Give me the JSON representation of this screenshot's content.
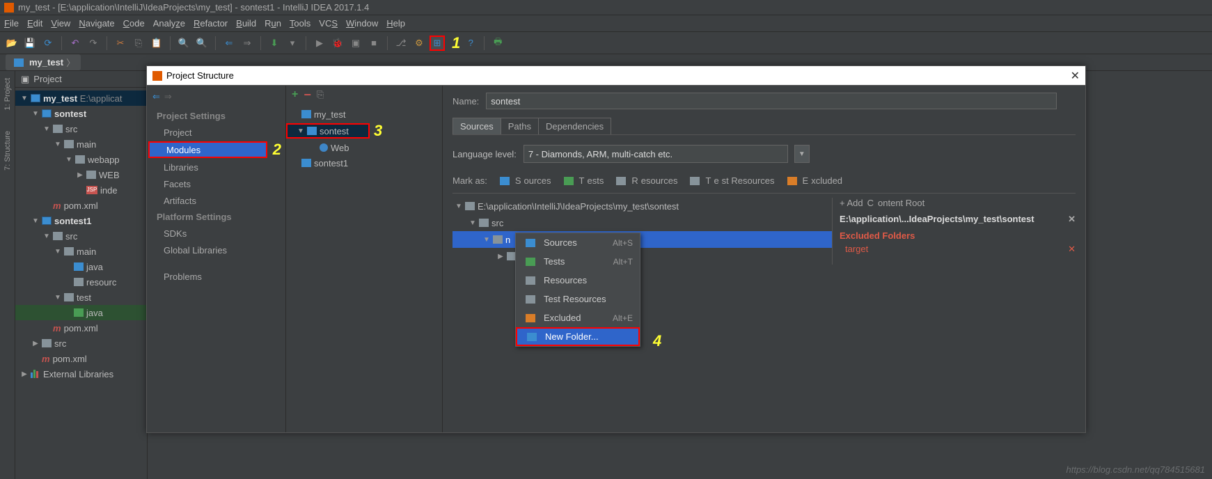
{
  "titlebar": "my_test - [E:\\application\\IntelliJ\\IdeaProjects\\my_test] - sontest1 - IntelliJ IDEA 2017.1.4",
  "menu": [
    "File",
    "Edit",
    "View",
    "Navigate",
    "Code",
    "Analyze",
    "Refactor",
    "Build",
    "Run",
    "Tools",
    "VCS",
    "Window",
    "Help"
  ],
  "breadcrumb": "my_test",
  "annotations": {
    "n1": "1",
    "n2": "2",
    "n3": "3",
    "n4": "4"
  },
  "rail": {
    "project": "1: Project",
    "structure": "7: Structure"
  },
  "projectPanel": {
    "title": "Project",
    "tree": {
      "root": "my_test",
      "rootPath": "E:\\applicat",
      "sontest": "sontest",
      "src1": "src",
      "main1": "main",
      "webapp": "webapp",
      "webinf": "WEB",
      "index": "inde",
      "pom1": "pom.xml",
      "sontest1": "sontest1",
      "src2": "src",
      "main2": "main",
      "java2": "java",
      "resources2": "resourc",
      "test2": "test",
      "java3": "java",
      "pom2": "pom.xml",
      "src3": "src",
      "pom3": "pom.xml",
      "ext": "External Libraries"
    }
  },
  "dialog": {
    "title": "Project Structure",
    "sidebar": {
      "h1": "Project Settings",
      "project": "Project",
      "modules": "Modules",
      "libraries": "Libraries",
      "facets": "Facets",
      "artifacts": "Artifacts",
      "h2": "Platform Settings",
      "sdks": "SDKs",
      "global": "Global Libraries",
      "problems": "Problems"
    },
    "modulesTree": {
      "root": "my_test",
      "sontest": "sontest",
      "web": "Web",
      "sontest1": "sontest1"
    },
    "content": {
      "nameLabel": "Name:",
      "name": "sontest",
      "tabSources": "Sources",
      "tabPaths": "Paths",
      "tabDeps": "Dependencies",
      "langLabel": "Language level:",
      "langLevel": "7 - Diamonds, ARM, multi-catch etc.",
      "markAs": "Mark as:",
      "mSources": "Sources",
      "mTests": "Tests",
      "mResources": "Resources",
      "mTestRes": "Test Resources",
      "mExcluded": "Excluded",
      "srcRoot": "E:\\application\\IntelliJ\\IdeaProjects\\my_test\\sontest",
      "srcDir": "src",
      "mainDir": "n",
      "subDir": "",
      "addRoot": "+ Add Content Root",
      "rootPath": "E:\\application\\...IdeaProjects\\my_test\\sontest",
      "excludedH": "Excluded Folders",
      "excludedItem": "target"
    },
    "context": {
      "sources": "Sources",
      "sourcesK": "Alt+S",
      "tests": "Tests",
      "testsK": "Alt+T",
      "resources": "Resources",
      "testRes": "Test Resources",
      "excluded": "Excluded",
      "excludedK": "Alt+E",
      "newFolder": "New Folder..."
    }
  },
  "watermark": "https://blog.csdn.net/qq784515681"
}
